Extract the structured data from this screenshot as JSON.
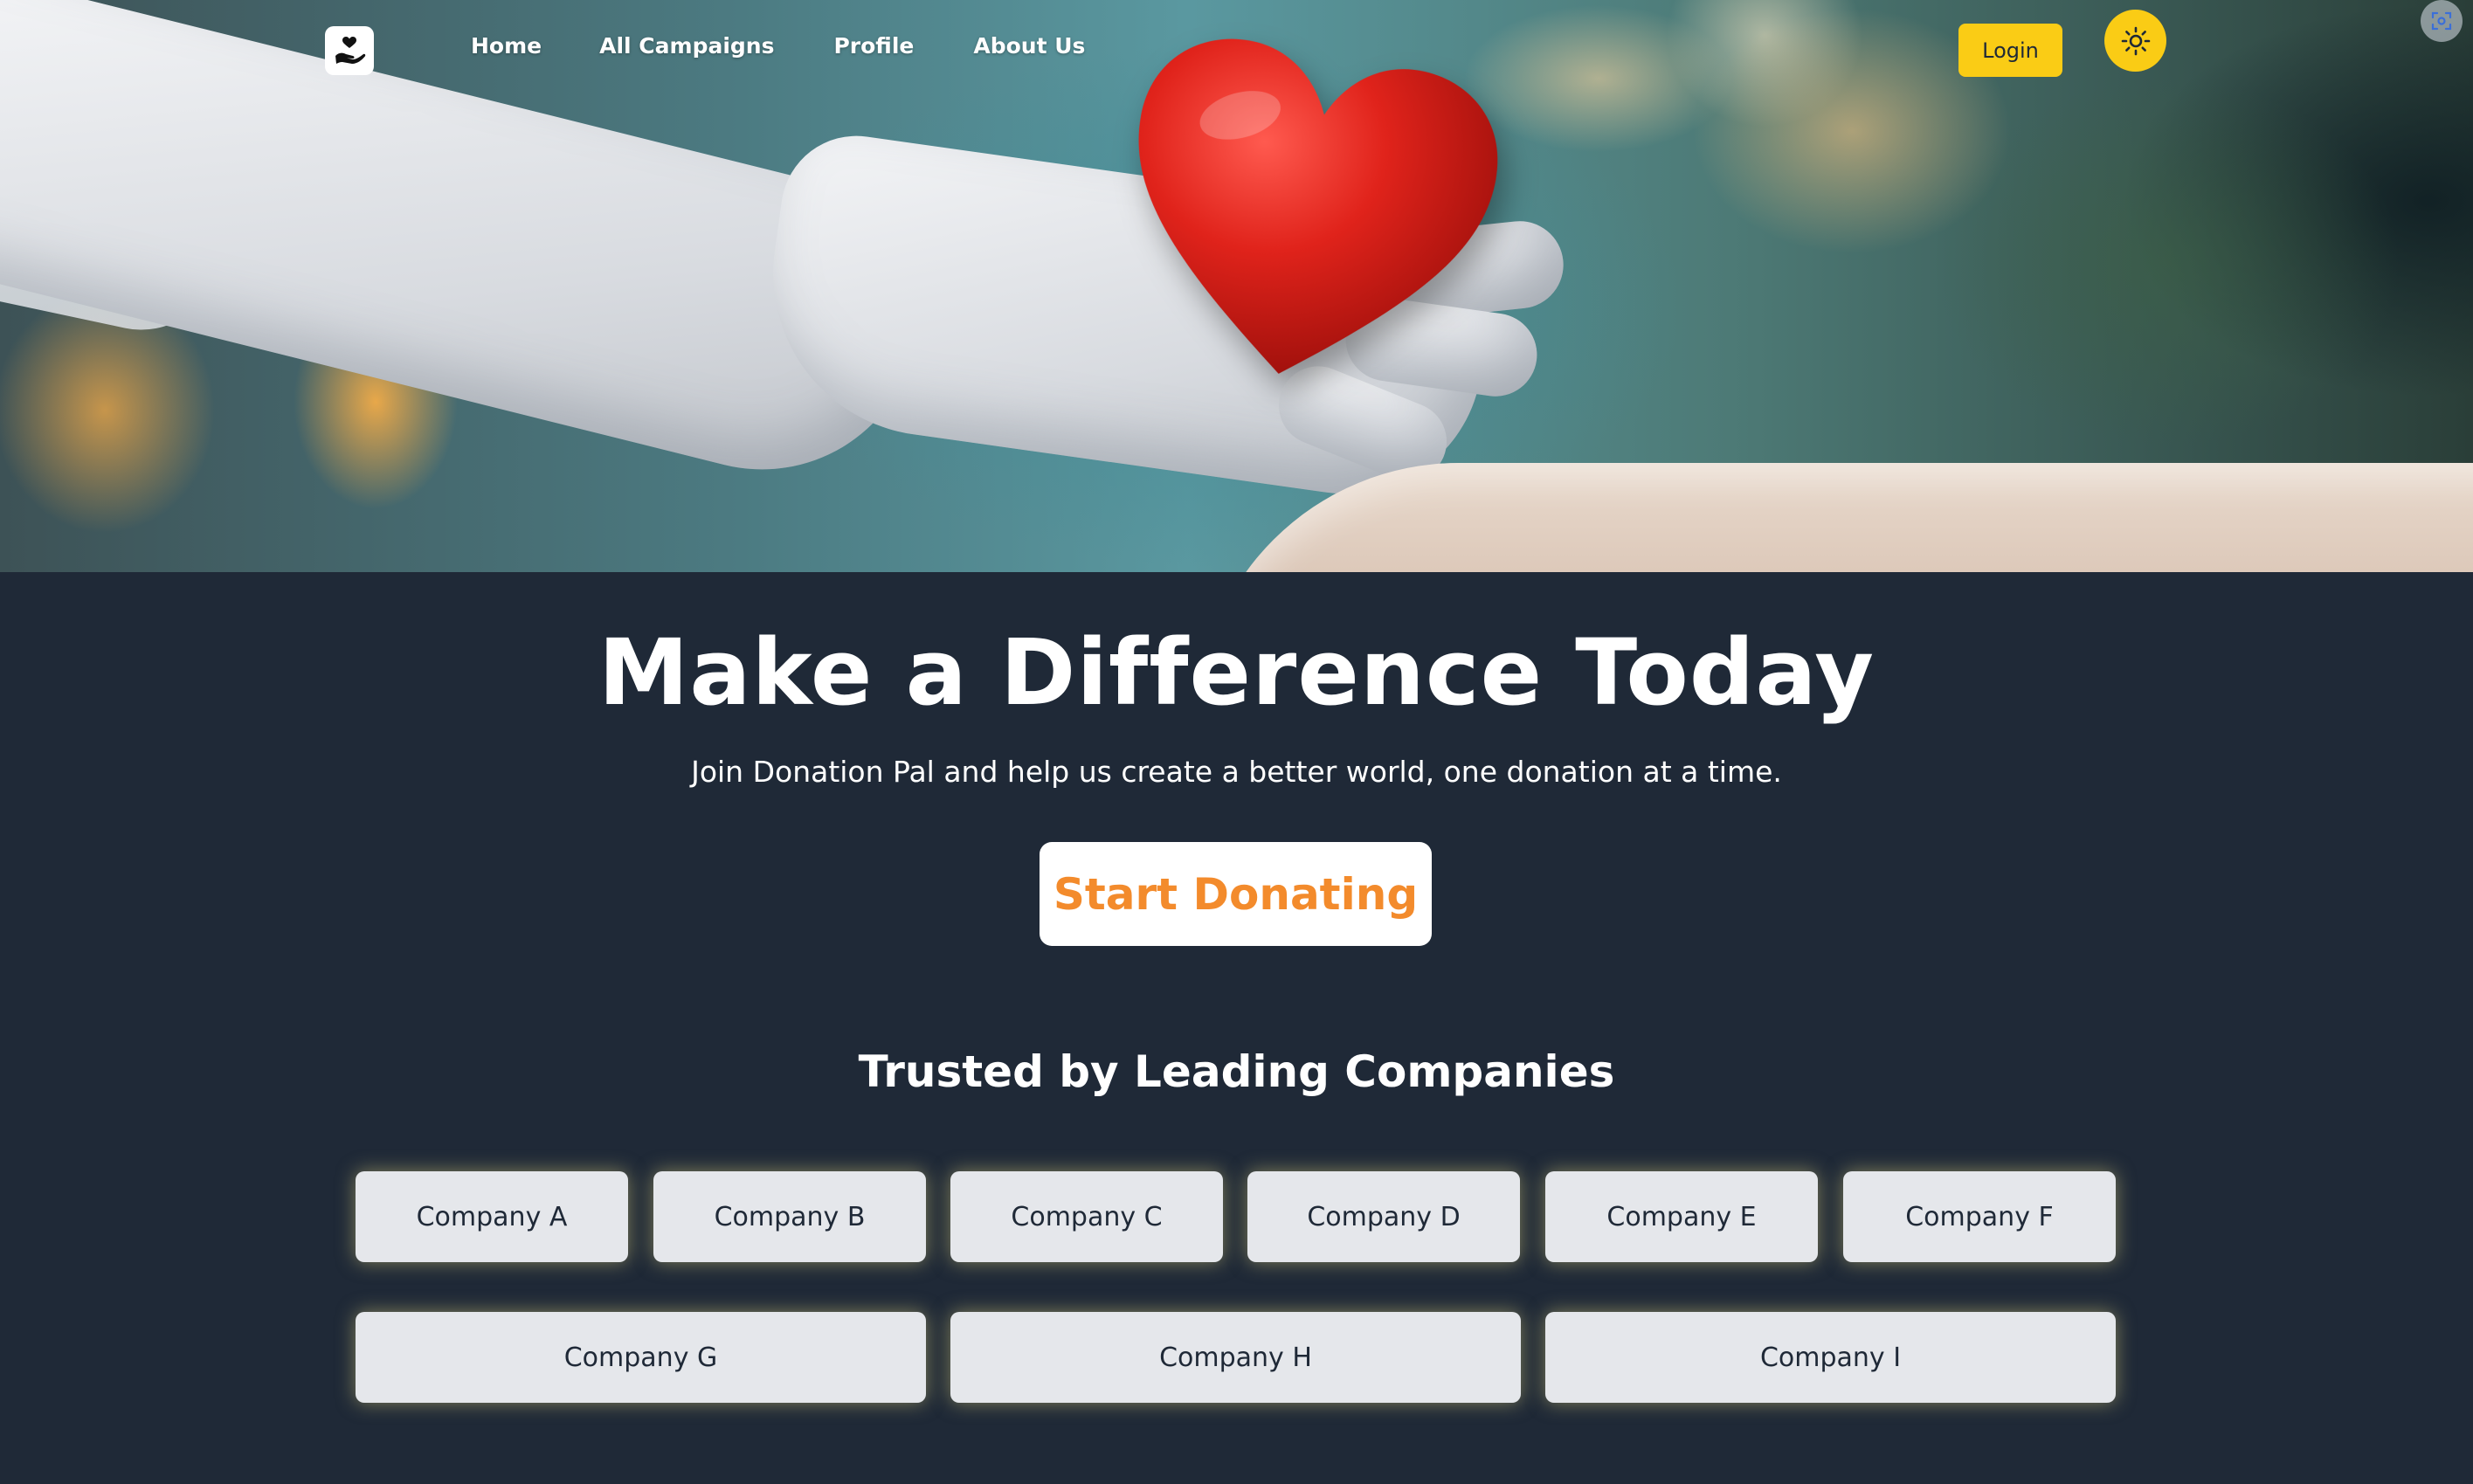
{
  "nav": {
    "logo_icon": "hand-holding-heart-icon",
    "links": [
      "Home",
      "All Campaigns",
      "Profile",
      "About Us"
    ],
    "login_label": "Login",
    "theme_icon": "sun-icon",
    "corner_icon": "screenshot-icon"
  },
  "hero": {
    "image": "gloved-hand-holding-red-heart",
    "headline": "Make a Difference Today",
    "subtext": "Join Donation Pal and help us create a better world, one donation at a time.",
    "cta_label": "Start Donating"
  },
  "companies": {
    "title": "Trusted by Leading Companies",
    "items": [
      "Company A",
      "Company B",
      "Company C",
      "Company D",
      "Company E",
      "Company F",
      "Company G",
      "Company H",
      "Company I"
    ]
  },
  "colors": {
    "background": "#1f2937",
    "accent_yellow": "#facc15",
    "cta_text": "#f38b2c",
    "card_bg": "#e5e7eb"
  }
}
